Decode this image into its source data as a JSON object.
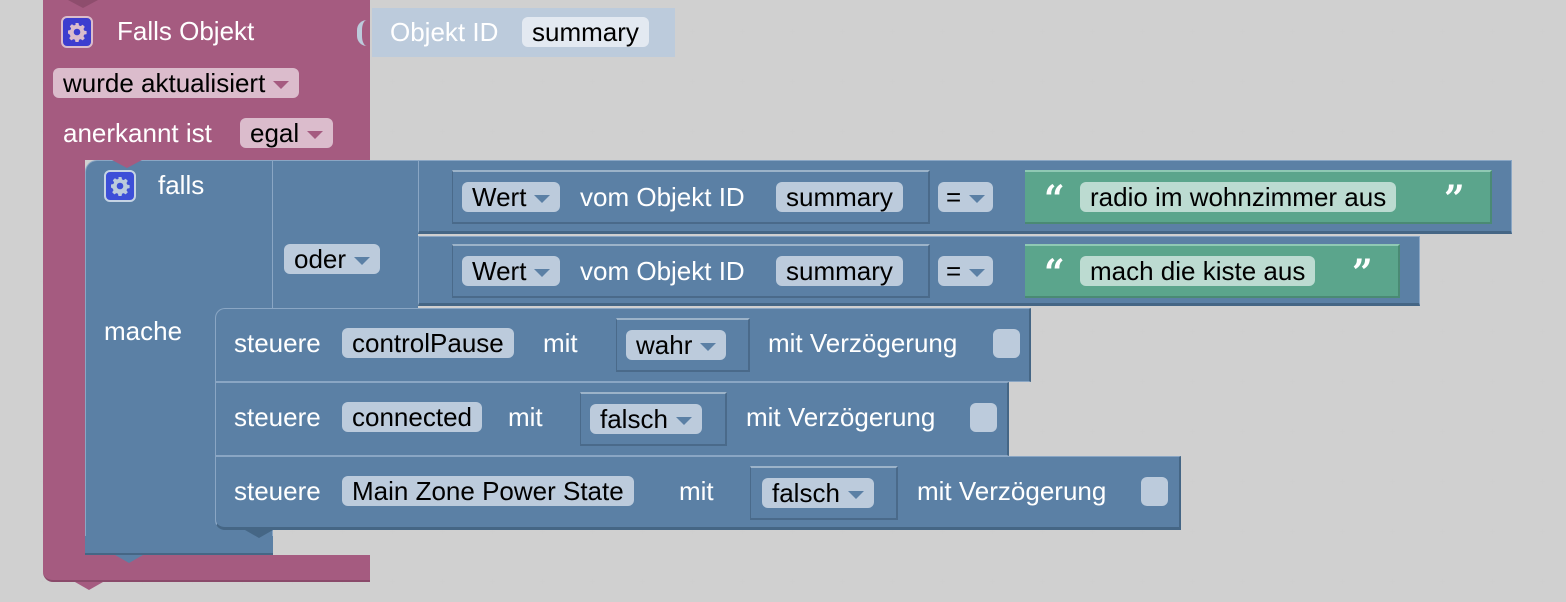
{
  "trigger_block": {
    "title": "Falls Objekt",
    "object_id_label": "Objekt ID",
    "object_id_value": "summary",
    "event_dropdown": "wurde aktualisiert",
    "ack_label": "anerkannt ist",
    "ack_dropdown": "egal",
    "color": "#a55b80"
  },
  "if_block": {
    "if_label": "falls",
    "do_label": "mache",
    "logic_operator": "oder",
    "color": "#5b80a5",
    "conditions": [
      {
        "property": "Wert",
        "of_object_label": "vom Objekt ID",
        "object_id": "summary",
        "comparator": "=",
        "text_value": "radio im wohnzimmer aus"
      },
      {
        "property": "Wert",
        "of_object_label": "vom Objekt ID",
        "object_id": "summary",
        "comparator": "=",
        "text_value": "mach die kiste aus"
      }
    ]
  },
  "actions": [
    {
      "verb": "steuere",
      "target": "controlPause",
      "with_label": "mit",
      "value": "wahr",
      "delay_label": "mit Verzögerung",
      "delay_checked": false
    },
    {
      "verb": "steuere",
      "target": "connected",
      "with_label": "mit",
      "value": "falsch",
      "delay_label": "mit Verzögerung",
      "delay_checked": false
    },
    {
      "verb": "steuere",
      "target": "Main Zone Power State",
      "with_label": "mit",
      "value": "falsch",
      "delay_label": "mit Verzögerung",
      "delay_checked": false
    }
  ],
  "icons": {
    "gear": "gear-icon",
    "open_quote": "“",
    "close_quote": "”"
  }
}
